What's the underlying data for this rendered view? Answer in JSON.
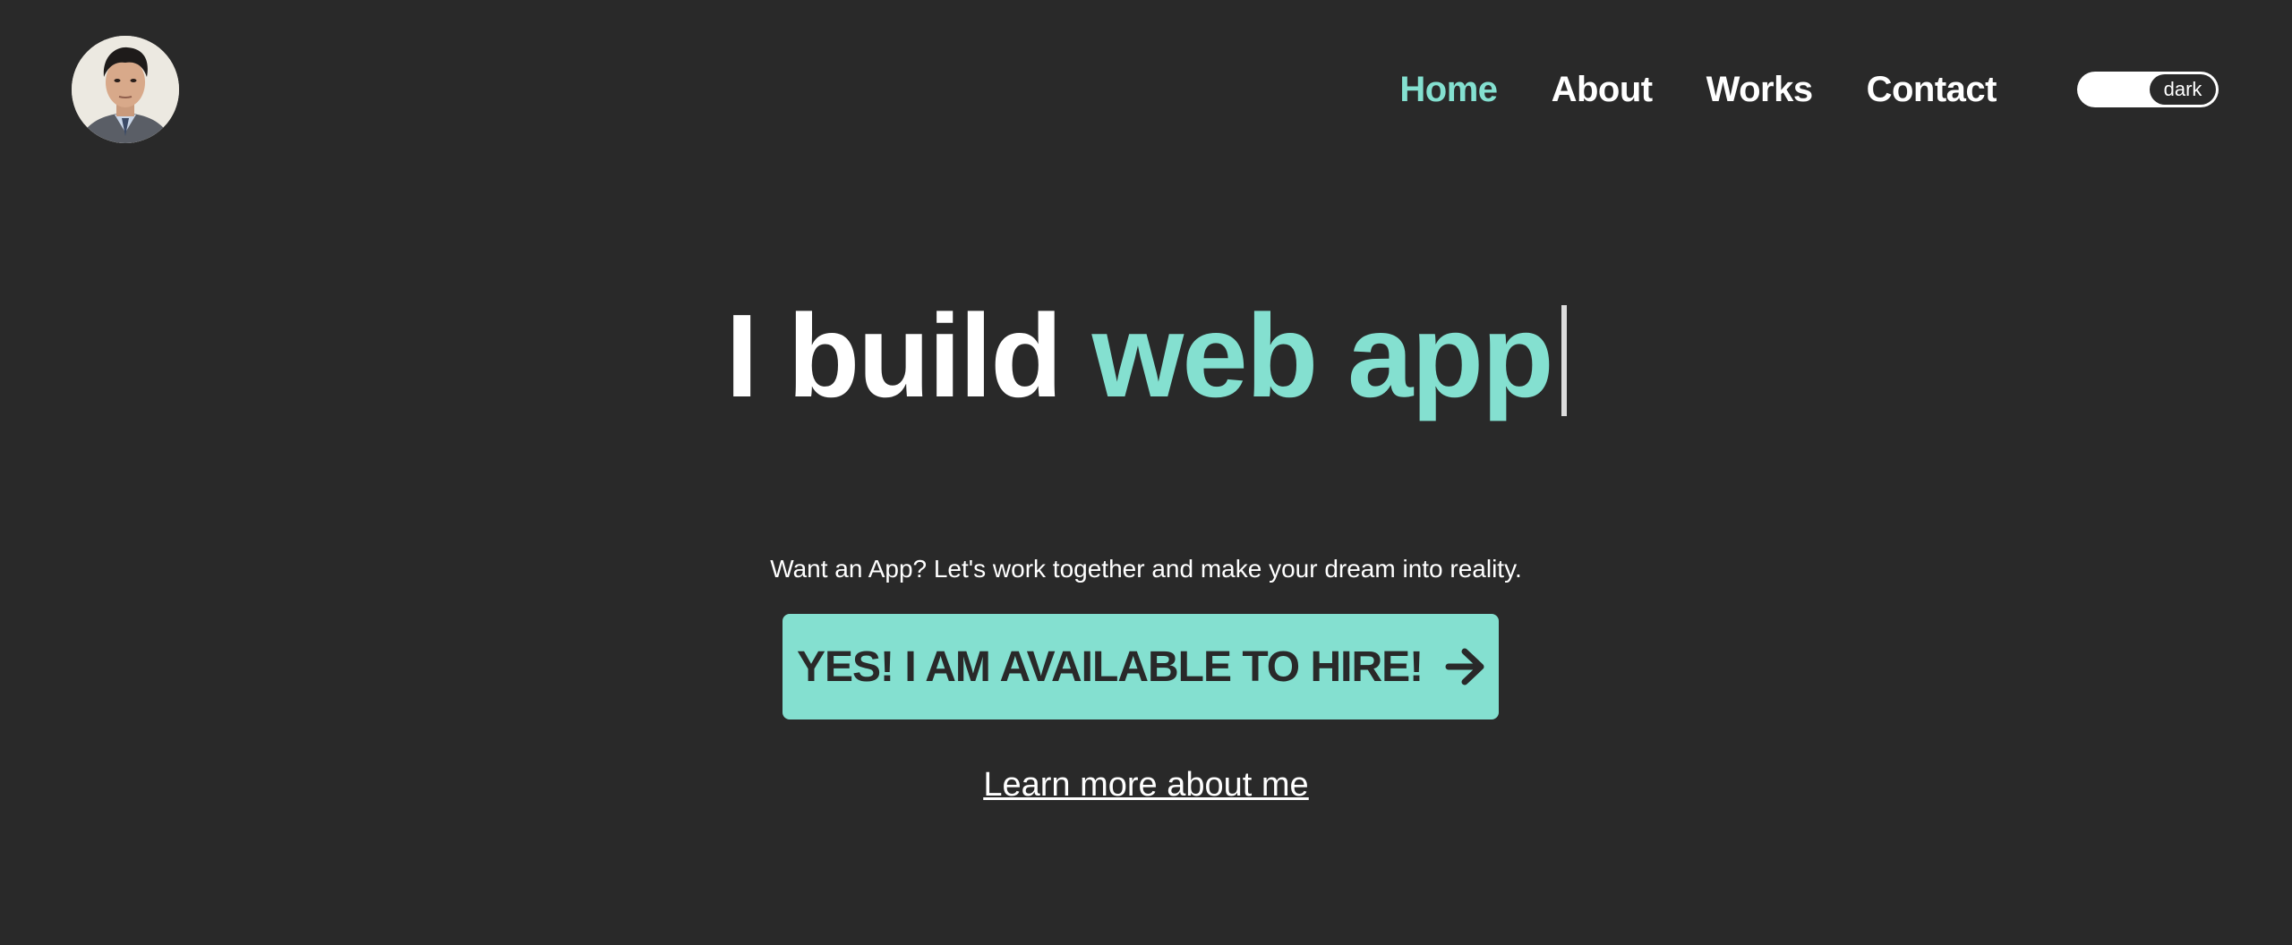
{
  "header": {
    "avatar_icon": "profile-photo",
    "nav": [
      {
        "label": "Home",
        "active": true
      },
      {
        "label": "About",
        "active": false
      },
      {
        "label": "Works",
        "active": false
      },
      {
        "label": "Contact",
        "active": false
      }
    ],
    "theme_toggle": {
      "label": "dark"
    }
  },
  "hero": {
    "title_prefix": "I build",
    "title_highlight": "web app",
    "tagline": "Want an App? Let's work together and make your dream into reality.",
    "cta_label": "YES! I AM AVAILABLE TO HIRE!",
    "cta_icon": "arrow-right-icon",
    "learn_more_label": "Learn more about me"
  },
  "colors": {
    "background": "#292929",
    "accent": "#84e0d0",
    "text": "#ffffff"
  }
}
